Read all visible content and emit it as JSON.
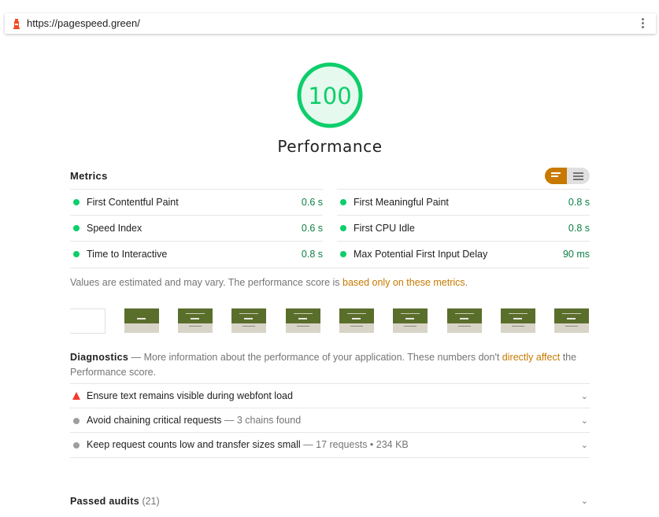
{
  "urlbar": {
    "url": "https://pagespeed.green/"
  },
  "gauge": {
    "score": "100",
    "title": "Performance",
    "color": "#0cce6b",
    "fill": "#e6f9ee"
  },
  "metrics": {
    "title": "Metrics",
    "items": [
      {
        "label": "First Contentful Paint",
        "value": "0.6 s"
      },
      {
        "label": "First Meaningful Paint",
        "value": "0.8 s"
      },
      {
        "label": "Speed Index",
        "value": "0.6 s"
      },
      {
        "label": "First CPU Idle",
        "value": "0.8 s"
      },
      {
        "label": "Time to Interactive",
        "value": "0.8 s"
      },
      {
        "label": "Max Potential First Input Delay",
        "value": "90 ms"
      }
    ],
    "note_prefix": "Values are estimated and may vary. The performance score is ",
    "note_link": "based only on these metrics",
    "note_suffix": "."
  },
  "diagnostics": {
    "title": "Diagnostics",
    "desc_prefix": " — More information about the performance of your application. These numbers don't ",
    "desc_link": "directly affect",
    "desc_suffix": " the Performance score.",
    "audits": [
      {
        "label": "Ensure text remains visible during webfont load",
        "display": "",
        "status": "fail"
      },
      {
        "label": "Avoid chaining critical requests",
        "display": " — 3 chains found",
        "status": "info"
      },
      {
        "label": "Keep request counts low and transfer sizes small",
        "display": " — 17 requests • 234 KB",
        "status": "info"
      }
    ]
  },
  "passed": {
    "title": "Passed audits",
    "count": " (21)"
  },
  "colors": {
    "pass": "#0cce6b",
    "fail": "#f33a2e",
    "accent": "#c77900"
  }
}
